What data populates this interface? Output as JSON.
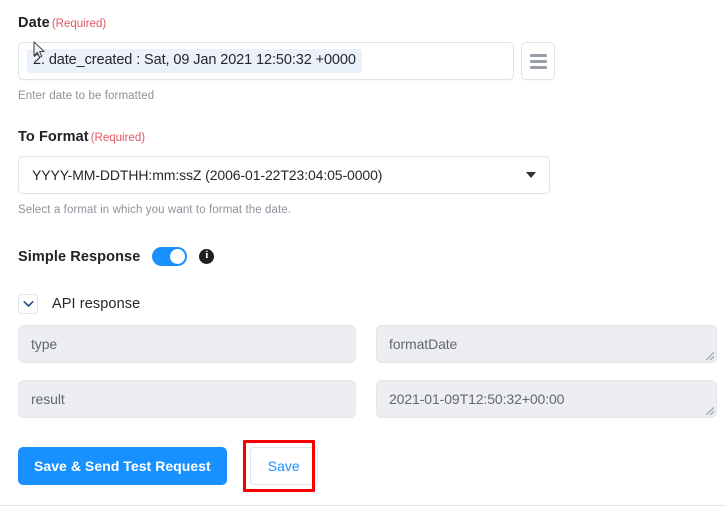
{
  "form": {
    "date_field": {
      "label": "Date",
      "required_tag": "(Required)",
      "token_value": "2. date_created : Sat, 09 Jan 2021 12:50:32 +0000",
      "helper_text": "Enter date to be formatted",
      "menu_icon": "hamburger-icon"
    },
    "to_format_field": {
      "label": "To Format",
      "required_tag": "(Required)",
      "selected_option": "YYYY-MM-DDTHH:mm:ssZ (2006-01-22T23:04:05-0000)",
      "helper_text": "Select a format in which you want to format the date.",
      "caret_icon": "chevron-down-icon"
    },
    "simple_response": {
      "label": "Simple Response",
      "toggle_state": "on",
      "info_icon": "info-icon",
      "info_glyph": "i"
    }
  },
  "api_response": {
    "section_title": "API response",
    "collapse_icon": "chevron-down-icon",
    "rows": [
      {
        "key": "type",
        "value": "formatDate"
      },
      {
        "key": "result",
        "value": "2021-01-09T12:50:32+00:00"
      }
    ]
  },
  "footer": {
    "primary_label": "Save & Send Test Request",
    "secondary_label": "Save"
  },
  "colors": {
    "accent_blue": "#1890ff",
    "required_red": "#e25563",
    "annotation_red": "#f80000",
    "field_bg_gray": "#eceef2",
    "token_bg": "#eaf1fb",
    "helper_gray": "#8d929b"
  }
}
